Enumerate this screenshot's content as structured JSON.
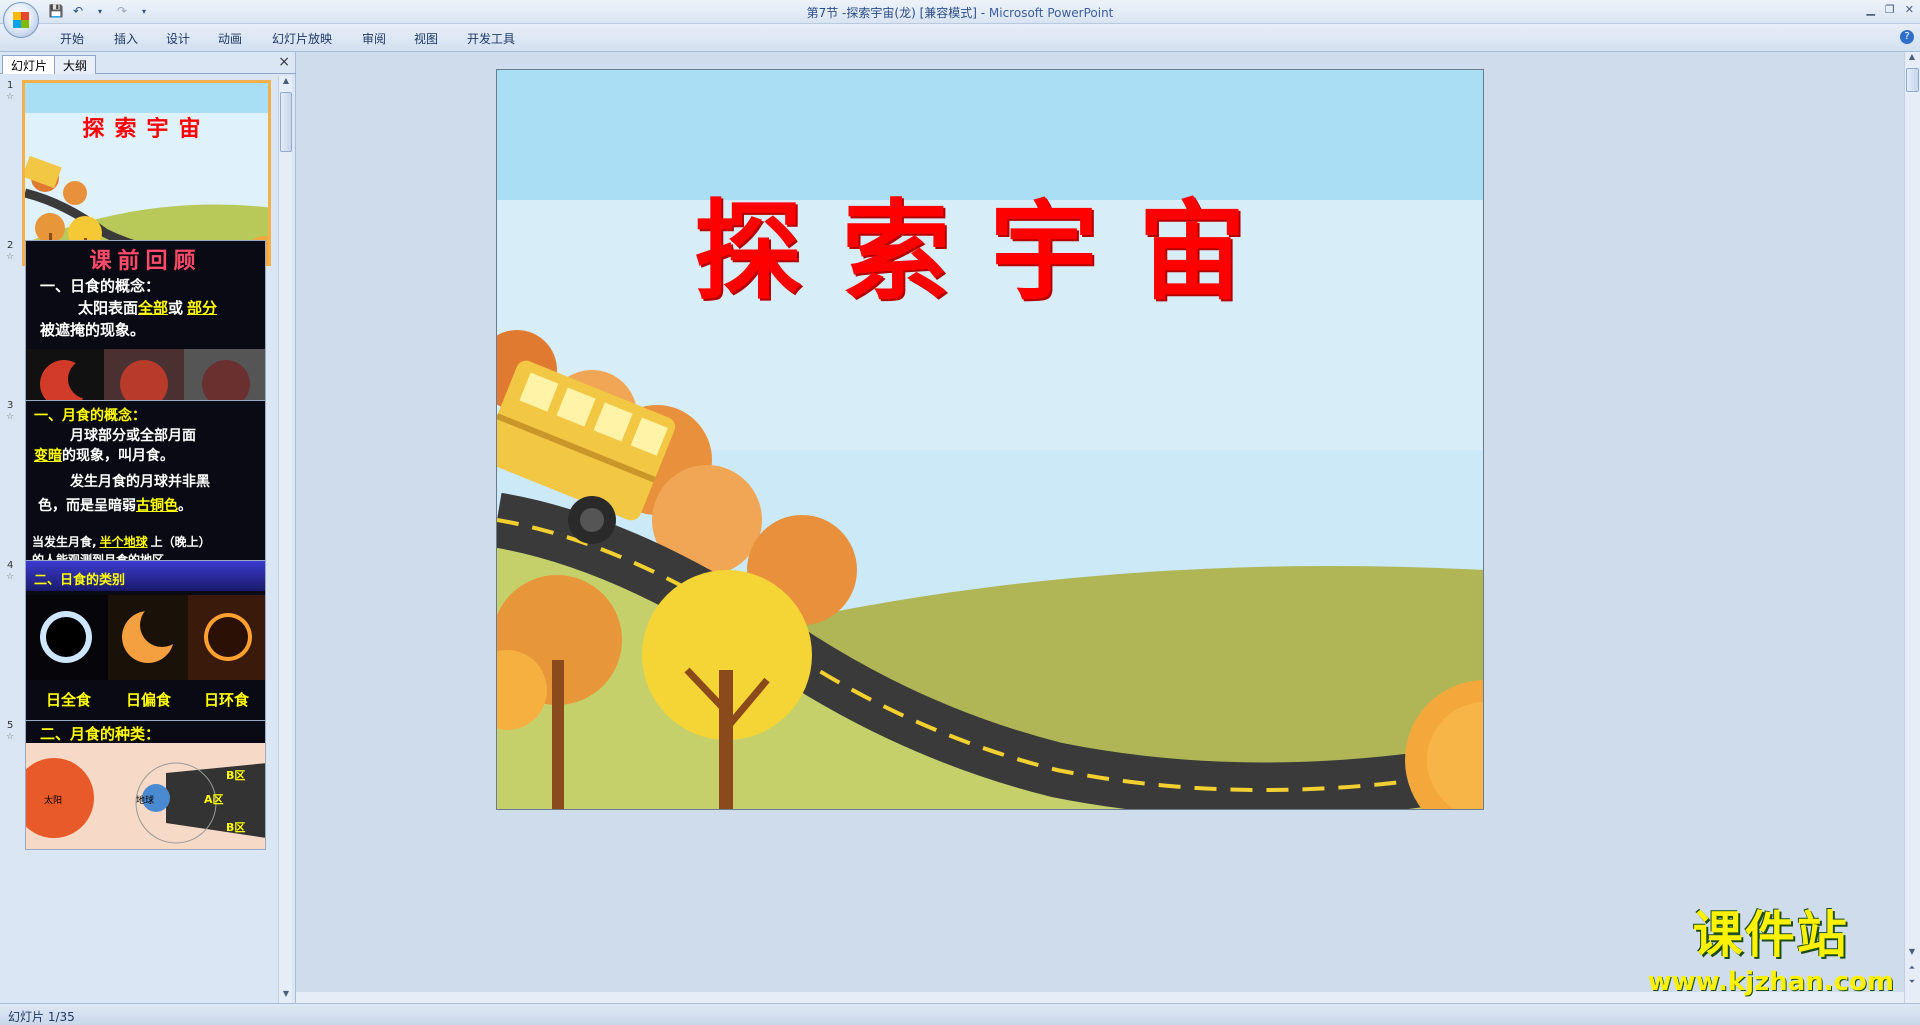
{
  "window": {
    "title": "第7节 -探索宇宙(龙) [兼容模式] - ",
    "app_name": "Microsoft PowerPoint"
  },
  "ribbon": {
    "tabs": [
      "开始",
      "插入",
      "设计",
      "动画",
      "幻灯片放映",
      "审阅",
      "视图",
      "开发工具"
    ]
  },
  "pane": {
    "tabs": [
      "幻灯片",
      "大纲"
    ],
    "close": "×"
  },
  "thumbnails": [
    {
      "num": "1",
      "title": "探索宇宙"
    },
    {
      "num": "2",
      "title": "课前回顾",
      "l1": "一、日食的概念：",
      "l2a": "太阳表面",
      "l2b": "全部",
      "l2c": "或",
      "l2d": "部分",
      "l3": "被遮掩的现象。"
    },
    {
      "num": "3",
      "l1": "一、月食的概念：",
      "l2": "月球部分或全部月面",
      "l3a": "变暗",
      "l3b": "的现象，叫月食。",
      "l4": "发生月食的月球并非黑",
      "l5a": "色，而是呈暗弱",
      "l5b": "古铜色",
      "l5c": "。",
      "l6a": "当发生月食,",
      "l6b": "半个地球",
      "l6c": "上（晚上）",
      "l7": "的人能观测到月食的地区。"
    },
    {
      "num": "4",
      "title": "二、日食的类别",
      "c1": "日全食",
      "c2": "日偏食",
      "c3": "日环食"
    },
    {
      "num": "5",
      "title": "二、月食的种类：",
      "sun": "太阳",
      "earth": "地球",
      "b1": "B区",
      "a": "A区",
      "b2": "B区"
    }
  ],
  "slide": {
    "title": "探索宇宙"
  },
  "watermark": {
    "cn": "课件站",
    "url": "www.kjzhan.com"
  },
  "status": {
    "slide_count": "幻灯片 1/35"
  },
  "colors": {
    "title_red": "#ff0000",
    "sky": "#dff1fb",
    "hill": "#b8c95a",
    "road": "#3a3a3a",
    "bus": "#f2c744"
  }
}
